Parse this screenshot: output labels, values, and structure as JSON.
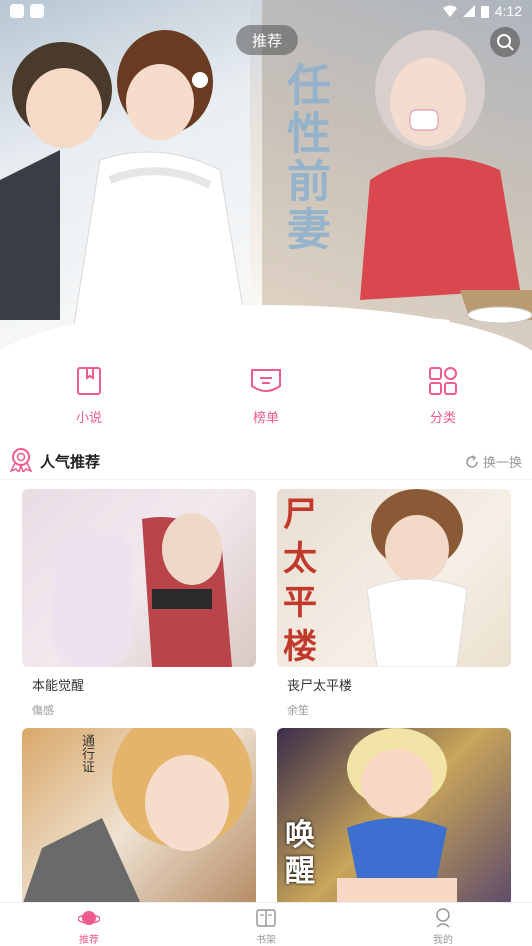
{
  "status_bar": {
    "time": "4:12"
  },
  "banner": {
    "tag": "推荐",
    "vertical_title": "任性前妻",
    "dots": 3,
    "active_dot": 2
  },
  "quick_nav": [
    {
      "label": "小说",
      "icon": "book-icon"
    },
    {
      "label": "榜单",
      "icon": "ranking-icon"
    },
    {
      "label": "分类",
      "icon": "category-icon"
    }
  ],
  "section": {
    "title": "人气推荐",
    "refresh_label": "换一换",
    "icon": "ribbon-icon"
  },
  "cards": [
    {
      "title": "本能觉醒",
      "author": "傷感",
      "overlay": ""
    },
    {
      "title": "丧尸太平楼",
      "author": "余笙",
      "overlay": "尸太平楼"
    },
    {
      "title": "",
      "author": "",
      "overlay": "通行证"
    },
    {
      "title": "",
      "author": "",
      "overlay": "唤醒"
    }
  ],
  "bottom_nav": [
    {
      "label": "推荐",
      "icon": "planet-icon",
      "active": true
    },
    {
      "label": "书架",
      "icon": "bookshelf-icon",
      "active": false
    },
    {
      "label": "我的",
      "icon": "profile-icon",
      "active": false
    }
  ],
  "colors": {
    "accent": "#ee5b8e",
    "text": "#222222",
    "muted": "#999999"
  }
}
